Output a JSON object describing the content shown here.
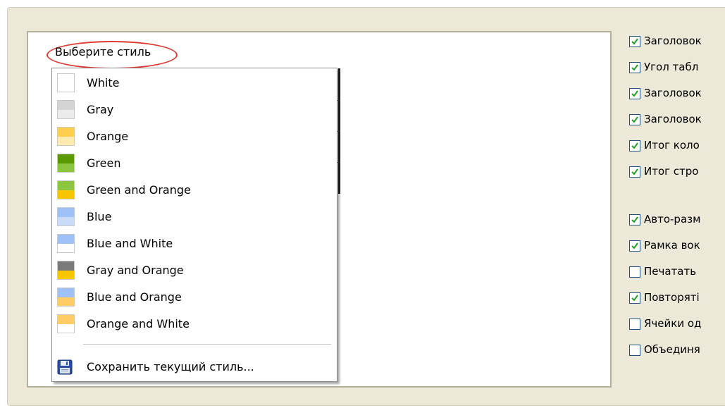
{
  "chooser": {
    "label": "Выберите стиль"
  },
  "menu": {
    "items": [
      {
        "label": "White",
        "top_color": "#ffffff",
        "bottom_color": "#ffffff"
      },
      {
        "label": "Gray",
        "top_color": "#d4d4d4",
        "bottom_color": "#ececec"
      },
      {
        "label": "Orange",
        "top_color": "#ffd04f",
        "bottom_color": "#ffeab0"
      },
      {
        "label": "Green",
        "top_color": "#5a9a00",
        "bottom_color": "#8cc63f"
      },
      {
        "label": "Green and Orange",
        "top_color": "#8cc63f",
        "bottom_color": "#f7c600"
      },
      {
        "label": "Blue",
        "top_color": "#9fc1f6",
        "bottom_color": "#cbdcf8"
      },
      {
        "label": "Blue and White",
        "top_color": "#9fc1f6",
        "bottom_color": "#ffffff"
      },
      {
        "label": "Gray and Orange",
        "top_color": "#7a7a7a",
        "bottom_color": "#f7c600"
      },
      {
        "label": "Blue and Orange",
        "top_color": "#9fc1f6",
        "bottom_color": "#ffcc66"
      },
      {
        "label": "Orange and White",
        "top_color": "#ffcc66",
        "bottom_color": "#ffffff"
      }
    ],
    "save_label": "Сохранить текущий стиль..."
  },
  "options": [
    {
      "label": "Заголовок",
      "checked": true
    },
    {
      "label": "Угол табл",
      "checked": true
    },
    {
      "label": "Заголовок",
      "checked": true
    },
    {
      "label": "Заголовок",
      "checked": true
    },
    {
      "label": "Итог коло",
      "checked": true
    },
    {
      "label": "Итог стро",
      "checked": true
    },
    {
      "label": "Авто-разм",
      "checked": true
    },
    {
      "label": "Рамка вок",
      "checked": true
    },
    {
      "label": "Печатать",
      "checked": false
    },
    {
      "label": "Повторяті",
      "checked": true
    },
    {
      "label": "Ячейки од",
      "checked": false
    },
    {
      "label": "Объединя",
      "checked": false
    }
  ]
}
